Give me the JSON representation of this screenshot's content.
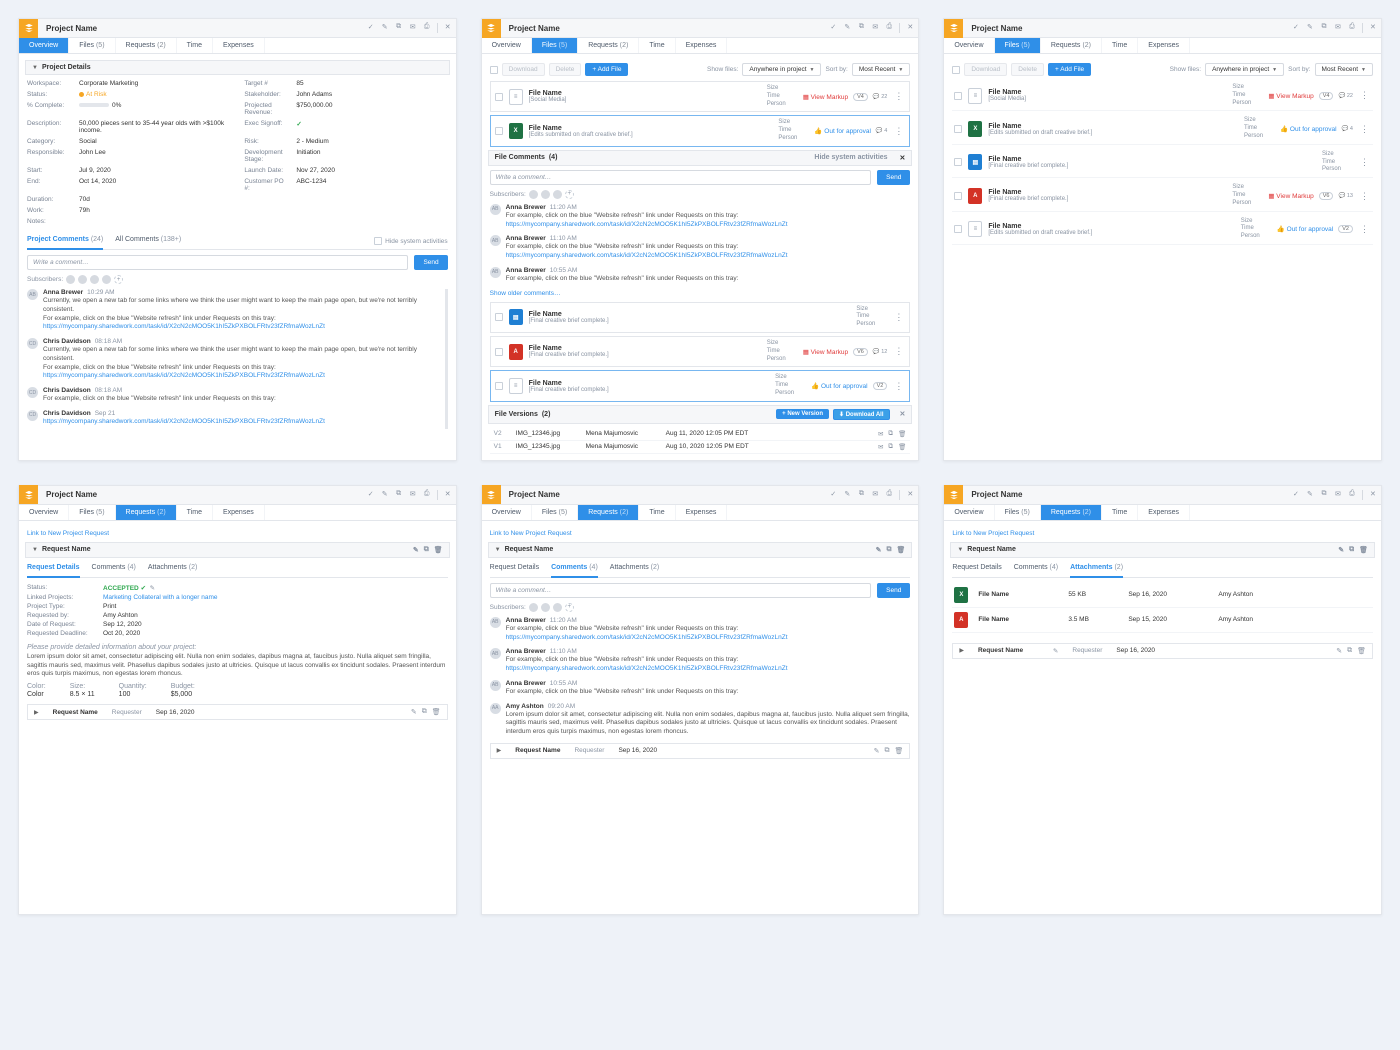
{
  "project_name": "Project Name",
  "tabs": {
    "overview": "Overview",
    "files": "Files",
    "files_cnt": "(5)",
    "requests": "Requests",
    "requests_cnt": "(2)",
    "time": "Time",
    "expenses": "Expenses"
  },
  "icons": {
    "check": "✓",
    "pencil": "✎",
    "copy": "⧉",
    "mail": "✉",
    "print": "⎙",
    "close": "✕",
    "download": "⬇",
    "link": "🔗",
    "trash": "🗑",
    "markup": "▦",
    "thumbs": "👍",
    "comment": "💬"
  },
  "details_title": "Project Details",
  "details_left": [
    {
      "l": "Workspace:",
      "v": "Corporate Marketing"
    },
    {
      "l": "Status:",
      "v": "At Risk",
      "status": true
    },
    {
      "l": "% Complete:",
      "v": "0%",
      "prog": true
    },
    {
      "l": "Description:",
      "v": "50,000 pieces sent to 35-44 year olds with >$100k income."
    },
    {
      "l": "Category:",
      "v": "Social"
    },
    {
      "l": "Responsible:",
      "v": "John Lee"
    },
    {
      "l": "Start:",
      "v": "Jul 9, 2020"
    },
    {
      "l": "End:",
      "v": "Oct 14, 2020"
    },
    {
      "l": "Duration:",
      "v": "70d"
    },
    {
      "l": "Work:",
      "v": "79h"
    },
    {
      "l": "Notes:",
      "v": ""
    }
  ],
  "details_right": [
    {
      "l": "Target #",
      "v": "85"
    },
    {
      "l": "Stakeholder:",
      "v": "John Adams"
    },
    {
      "l": "Projected Revenue:",
      "v": "$750,000.00"
    },
    {
      "l": "Exec Signoff:",
      "v": "✓",
      "check": true
    },
    {
      "l": "Risk:",
      "v": "2 - Medium"
    },
    {
      "l": "Development Stage:",
      "v": "Initiation"
    },
    {
      "l": "Launch Date:",
      "v": "Nov 27, 2020"
    },
    {
      "l": "Customer PO #:",
      "v": "ABC-1234"
    }
  ],
  "comments": {
    "tabs": {
      "project": "Project Comments",
      "project_cnt": "(24)",
      "all": "All Comments",
      "all_cnt": "(138+)"
    },
    "hide_sys": "Hide system activities",
    "placeholder": "Write a comment…",
    "send": "Send",
    "subscribers": "Subscribers:",
    "items": [
      {
        "a": "AB",
        "author": "Anna Brewer",
        "time": "10:29 AM",
        "text": "Currently, we open a new tab for some links where we think the user might want to keep the main page open, but we're not terribly consistent.\nFor example, click on the blue \"Website refresh\" link under Requests on this tray:",
        "link": "https://mycompany.sharedwork.com/task/id/X2cN2cMOO5K1hI5ZkPXBOLFRtv23fZRfmaWozLnZt"
      },
      {
        "a": "CD",
        "author": "Chris Davidson",
        "time": "08:18 AM",
        "text": "Currently, we open a new tab for some links where we think the user might want to keep the main page open, but we're not terribly consistent.\nFor example, click on the blue \"Website refresh\" link under Requests on this tray:",
        "link": "https://mycompany.sharedwork.com/task/id/X2cN2cMOO5K1hI5ZkPXBOLFRtv23fZRfmaWozLnZt"
      },
      {
        "a": "CD",
        "author": "Chris Davidson",
        "time": "08:18 AM",
        "text": "For example, click on the blue \"Website refresh\" link under Requests on this tray:"
      },
      {
        "a": "CD",
        "author": "Chris Davidson",
        "time": "Sep 21",
        "link": "https://mycompany.sharedwork.com/task/id/X2cN2cMOO5K1hI5ZkPXBOLFRtv23fZRfmaWozLnZt"
      }
    ]
  },
  "files_toolbar": {
    "download": "Download",
    "delete": "Delete",
    "add": "+ Add File",
    "show": "Show files:",
    "sort": "Sort by:",
    "scope": "Anywhere in project",
    "sortv": "Most Recent"
  },
  "files": [
    {
      "sel": false,
      "type": "outline",
      "name": "File Name",
      "sub": "[Social Media]",
      "action": "View Markup",
      "acolor": "red",
      "badge": "V4",
      "cc": "22"
    },
    {
      "sel": true,
      "type": "xls",
      "name": "File Name",
      "sub": "[Edits submitted on draft creative brief.]",
      "action": "Out for approval",
      "acolor": "blue",
      "cc": "4"
    },
    {
      "type": "img",
      "name": "File Name",
      "sub": "[Final creative brief complete.]"
    },
    {
      "type": "pdf",
      "name": "File Name",
      "sub": "[Final creative brief complete.]",
      "action": "View Markup",
      "acolor": "red",
      "badge": "V6",
      "cc": "12"
    },
    {
      "sel": true,
      "type": "outline",
      "name": "File Name",
      "sub": "[Final creative brief complete.]",
      "action": "Out for approval",
      "acolor": "blue",
      "badge": "V2"
    }
  ],
  "files3": [
    {
      "type": "outline",
      "name": "File Name",
      "sub": "[Social Media]",
      "action": "View Markup",
      "acolor": "red",
      "badge": "V4",
      "cc": "22"
    },
    {
      "type": "xls",
      "name": "File Name",
      "sub": "[Edits submitted on draft creative brief.]",
      "action": "Out for approval",
      "acolor": "blue",
      "cc": "4"
    },
    {
      "type": "img",
      "name": "File Name",
      "sub": "[Final creative brief complete.]"
    },
    {
      "type": "pdf",
      "name": "File Name",
      "sub": "[Final creative brief complete.]",
      "action": "View Markup",
      "acolor": "red",
      "badge": "V6",
      "cc": "13"
    },
    {
      "type": "outline",
      "name": "File Name",
      "sub": "[Edits submitted on draft creative brief.]",
      "action": "Out for approval",
      "acolor": "blue",
      "badge": "V2"
    }
  ],
  "file_comments": {
    "title": "File Comments",
    "cnt": "(4)",
    "hide_sys": "Hide system activities",
    "close": "✕",
    "items": [
      {
        "a": "AB",
        "author": "Anna Brewer",
        "time": "11:20 AM",
        "text": "For example, click on the blue \"Website refresh\" link under Requests on this tray:",
        "link": "https://mycompany.sharedwork.com/task/id/X2cN2cMOO5K1hI5ZkPXBOLFRtv23fZRfmaWozLnZt"
      },
      {
        "a": "AB",
        "author": "Anna Brewer",
        "time": "11:10 AM",
        "text": "For example, click on the blue \"Website refresh\" link under Requests on this tray:",
        "link": "https://mycompany.sharedwork.com/task/id/X2cN2cMOO5K1hI5ZkPXBOLFRtv23fZRfmaWozLnZt"
      },
      {
        "a": "AB",
        "author": "Anna Brewer",
        "time": "10:55 AM",
        "text": "For example, click on the blue \"Website refresh\" link under Requests on this tray:"
      }
    ],
    "show_older": "Show older comments…"
  },
  "versions": {
    "title": "File Versions",
    "cnt": "(2)",
    "new": "+ New Version",
    "dl": "⬇ Download All",
    "rows": [
      {
        "v": "V2",
        "fn": "IMG_12346.jpg",
        "au": "Mena Majumosvic",
        "dt": "Aug 11, 2020 12:05 PM EDT"
      },
      {
        "v": "V1",
        "fn": "IMG_12345.jpg",
        "au": "Mena Majumosvic",
        "dt": "Aug 10, 2020 12:05 PM EDT"
      }
    ]
  },
  "request": {
    "linknew": "Link to New Project Request",
    "name": "Request Name",
    "subtabs": {
      "details": "Request Details",
      "comments": "Comments",
      "comments_cnt": "(4)",
      "attachments": "Attachments",
      "attachments_cnt": "(2)"
    },
    "details": [
      {
        "l": "Status:",
        "v": "ACCEPTED",
        "accepted": true
      },
      {
        "l": "Linked Projects:",
        "v": "Marketing Collateral with a longer name",
        "link": true
      },
      {
        "l": "Project Type:",
        "v": "Print"
      },
      {
        "l": "Requested by:",
        "v": "Amy Ashton"
      },
      {
        "l": "Date of Request:",
        "v": "Sep 12, 2020"
      },
      {
        "l": "Requested Deadline:",
        "v": "Oct 20, 2020"
      }
    ],
    "brief_label": "Please provide detailed information about your project:",
    "brief": "Lorem ipsum dolor sit amet, consectetur adipiscing elit. Nulla non enim sodales, dapibus magna at, faucibus justo. Nulla aliquet sem fringilla, sagittis mauris sed, maximus velit. Phasellus dapibus sodales justo at ultricies. Quisque ut lacus convallis ex tincidunt sodales. Praesent interdum eros quis turpis maximus, non egestas lorem rhoncus.",
    "extras": [
      {
        "l": "Color:",
        "v": "Color"
      },
      {
        "l": "Size:",
        "v": "8.5 × 11"
      },
      {
        "l": "Quantity:",
        "v": "100"
      },
      {
        "l": "Budget:",
        "v": "$5,000"
      }
    ],
    "collapsed": {
      "name": "Request Name",
      "requester": "Requester",
      "date": "Sep 16, 2020"
    }
  },
  "req_comments": {
    "items": [
      {
        "a": "AB",
        "author": "Anna Brewer",
        "time": "11:20 AM",
        "text": "For example, click on the blue \"Website refresh\" link under Requests on this tray:",
        "link": "https://mycompany.sharedwork.com/task/id/X2cN2cMOO5K1hI5ZkPXBOLFRtv23fZRfmaWozLnZt"
      },
      {
        "a": "AB",
        "author": "Anna Brewer",
        "time": "11:10 AM",
        "text": "For example, click on the blue \"Website refresh\" link under Requests on this tray:",
        "link": "https://mycompany.sharedwork.com/task/id/X2cN2cMOO5K1hI5ZkPXBOLFRtv23fZRfmaWozLnZt"
      },
      {
        "a": "AB",
        "author": "Anna Brewer",
        "time": "10:55 AM",
        "text": "For example, click on the blue \"Website refresh\" link under Requests on this tray:"
      },
      {
        "a": "AA",
        "author": "Amy Ashton",
        "time": "09:20 AM",
        "text": "Lorem ipsum dolor sit amet, consectetur adipiscing elit. Nulla non enim sodales, dapibus magna at, faucibus justo. Nulla aliquet sem fringilla, sagittis mauris sed, maximus velit. Phasellus dapibus sodales justo at ultricies. Quisque ut lacus convallis ex tincidunt sodales. Praesent interdum eros quis turpis maximus, non egestas lorem rhoncus."
      }
    ]
  },
  "attachments": [
    {
      "type": "xls",
      "fn": "File Name",
      "sz": "55 KB",
      "dt": "Sep 16, 2020",
      "ow": "Amy Ashton"
    },
    {
      "type": "pdf",
      "fn": "File Name",
      "sz": "3.5 MB",
      "dt": "Sep 15, 2020",
      "ow": "Amy Ashton"
    }
  ],
  "req6_collapsed": {
    "name": "Request Name",
    "edit": "✎",
    "requester": "Requester",
    "date": "Sep 16, 2020"
  }
}
